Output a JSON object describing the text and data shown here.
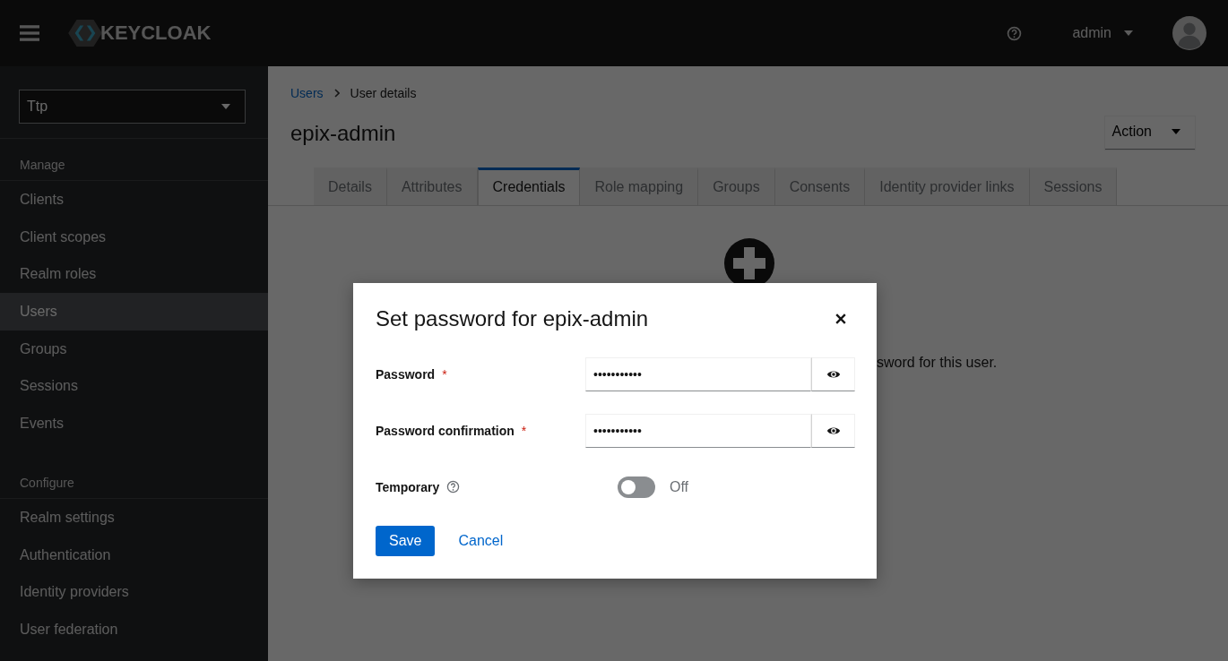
{
  "header": {
    "logo_text": "KEYCLOAK",
    "user": "admin"
  },
  "sidebar": {
    "realm": "Ttp",
    "sections": [
      {
        "title": "Manage",
        "items": [
          {
            "label": "Clients",
            "selected": false
          },
          {
            "label": "Client scopes",
            "selected": false
          },
          {
            "label": "Realm roles",
            "selected": false
          },
          {
            "label": "Users",
            "selected": true
          },
          {
            "label": "Groups",
            "selected": false
          },
          {
            "label": "Sessions",
            "selected": false
          },
          {
            "label": "Events",
            "selected": false
          }
        ]
      },
      {
        "title": "Configure",
        "items": [
          {
            "label": "Realm settings",
            "selected": false
          },
          {
            "label": "Authentication",
            "selected": false
          },
          {
            "label": "Identity providers",
            "selected": false
          },
          {
            "label": "User federation",
            "selected": false
          }
        ]
      }
    ]
  },
  "main": {
    "breadcrumb": [
      "Users",
      "User details"
    ],
    "title": "epix-admin",
    "action": "Action",
    "tabs": [
      {
        "label": "Details",
        "selected": false
      },
      {
        "label": "Attributes",
        "selected": false
      },
      {
        "label": "Credentials",
        "selected": true
      },
      {
        "label": "Role mapping",
        "selected": false
      },
      {
        "label": "Groups",
        "selected": false
      },
      {
        "label": "Consents",
        "selected": false
      },
      {
        "label": "Identity provider links",
        "selected": false
      },
      {
        "label": "Sessions",
        "selected": false
      }
    ],
    "empty_state_text": "sword for this user."
  },
  "dialog": {
    "title": "Set password for epix-admin",
    "fields": [
      {
        "label": "Password",
        "required": true,
        "value": "•••••••••••"
      },
      {
        "label": "Password confirmation",
        "required": true,
        "value": "•••••••••••"
      }
    ],
    "temporary": {
      "label": "Temporary",
      "on": false,
      "state_text": "Off"
    },
    "required_mark": "*",
    "save": "Save",
    "cancel": "Cancel"
  }
}
